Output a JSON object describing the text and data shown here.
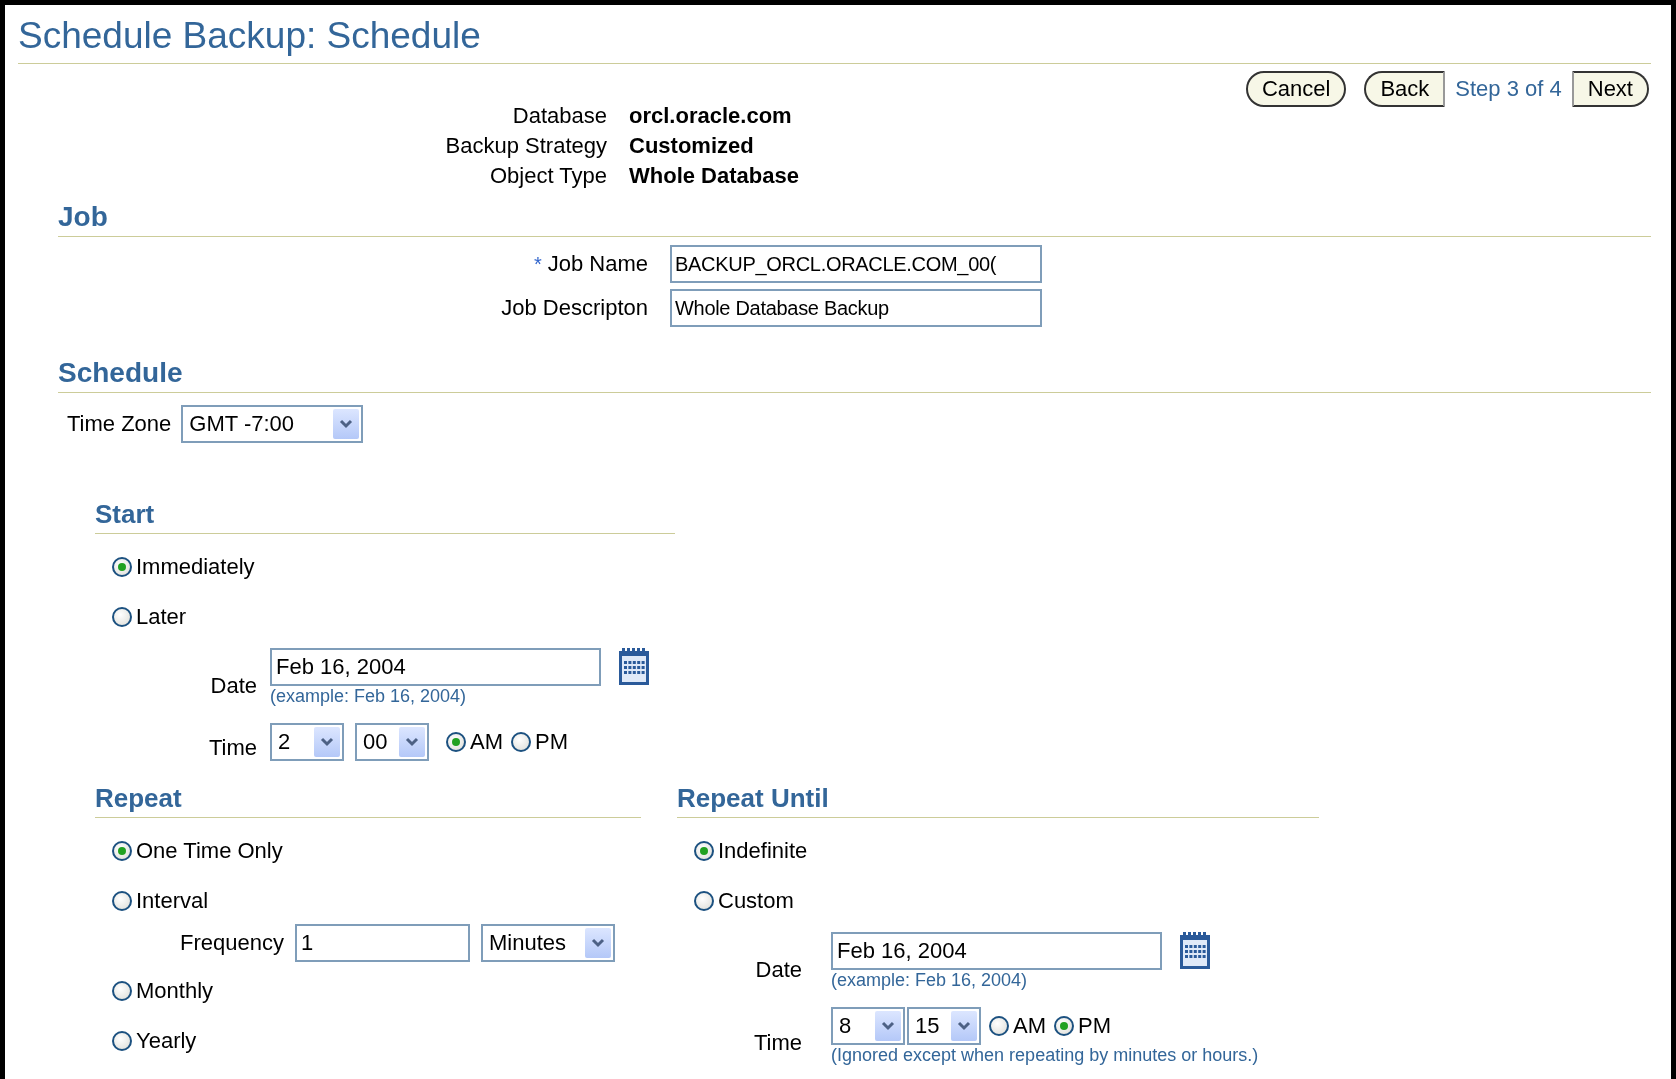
{
  "title": "Schedule Backup: Schedule",
  "navigation": [
    {
      "kind": "round",
      "label": "Cancel"
    },
    {
      "kind": "left",
      "label": "Back"
    },
    {
      "kind": "step",
      "label": "Step 3 of 4"
    },
    {
      "kind": "right",
      "label": "Next"
    }
  ],
  "info": [
    {
      "label": "Database",
      "value": "orcl.oracle.com"
    },
    {
      "label": "Backup Strategy",
      "value": "Customized"
    },
    {
      "label": "Object Type",
      "value": "Whole Database"
    }
  ],
  "job": {
    "heading": "Job",
    "required_mark": "*",
    "fields": [
      {
        "label": "Job Name",
        "required": true,
        "value": "BACKUP_ORCL.ORACLE.COM_00("
      },
      {
        "label": "Job Descripton",
        "required": false,
        "value": "Whole Database Backup"
      }
    ]
  },
  "schedule": {
    "heading": "Schedule",
    "time_zone": {
      "label": "Time Zone",
      "value": "GMT -7:00"
    }
  },
  "start": {
    "heading": "Start",
    "options": [
      {
        "label": "Immediately",
        "selected": true
      },
      {
        "label": "Later",
        "selected": false
      }
    ],
    "date": {
      "label": "Date",
      "value": "Feb 16, 2004",
      "hint": "(example: Feb 16, 2004)"
    },
    "time": {
      "label": "Time",
      "hour": "2",
      "minute": "00",
      "periods": [
        {
          "label": "AM",
          "selected": true
        },
        {
          "label": "PM",
          "selected": false
        }
      ]
    }
  },
  "repeat": {
    "heading": "Repeat",
    "options": [
      {
        "label": "One Time Only",
        "selected": true
      },
      {
        "label": "Interval",
        "selected": false
      },
      {
        "label": "Monthly",
        "selected": false
      },
      {
        "label": "Yearly",
        "selected": false
      }
    ],
    "frequency": {
      "label": "Frequency",
      "value": "1",
      "unit": "Minutes"
    }
  },
  "repeat_until": {
    "heading": "Repeat Until",
    "options": [
      {
        "label": "Indefinite",
        "selected": true
      },
      {
        "label": "Custom",
        "selected": false
      }
    ],
    "date": {
      "label": "Date",
      "value": "Feb 16, 2004",
      "hint": "(example: Feb 16, 2004)"
    },
    "time": {
      "label": "Time",
      "hour": "8",
      "minute": "15",
      "periods": [
        {
          "label": "AM",
          "selected": false
        },
        {
          "label": "PM",
          "selected": true
        }
      ]
    },
    "note": "(Ignored except when repeating by minutes or hours.)"
  }
}
